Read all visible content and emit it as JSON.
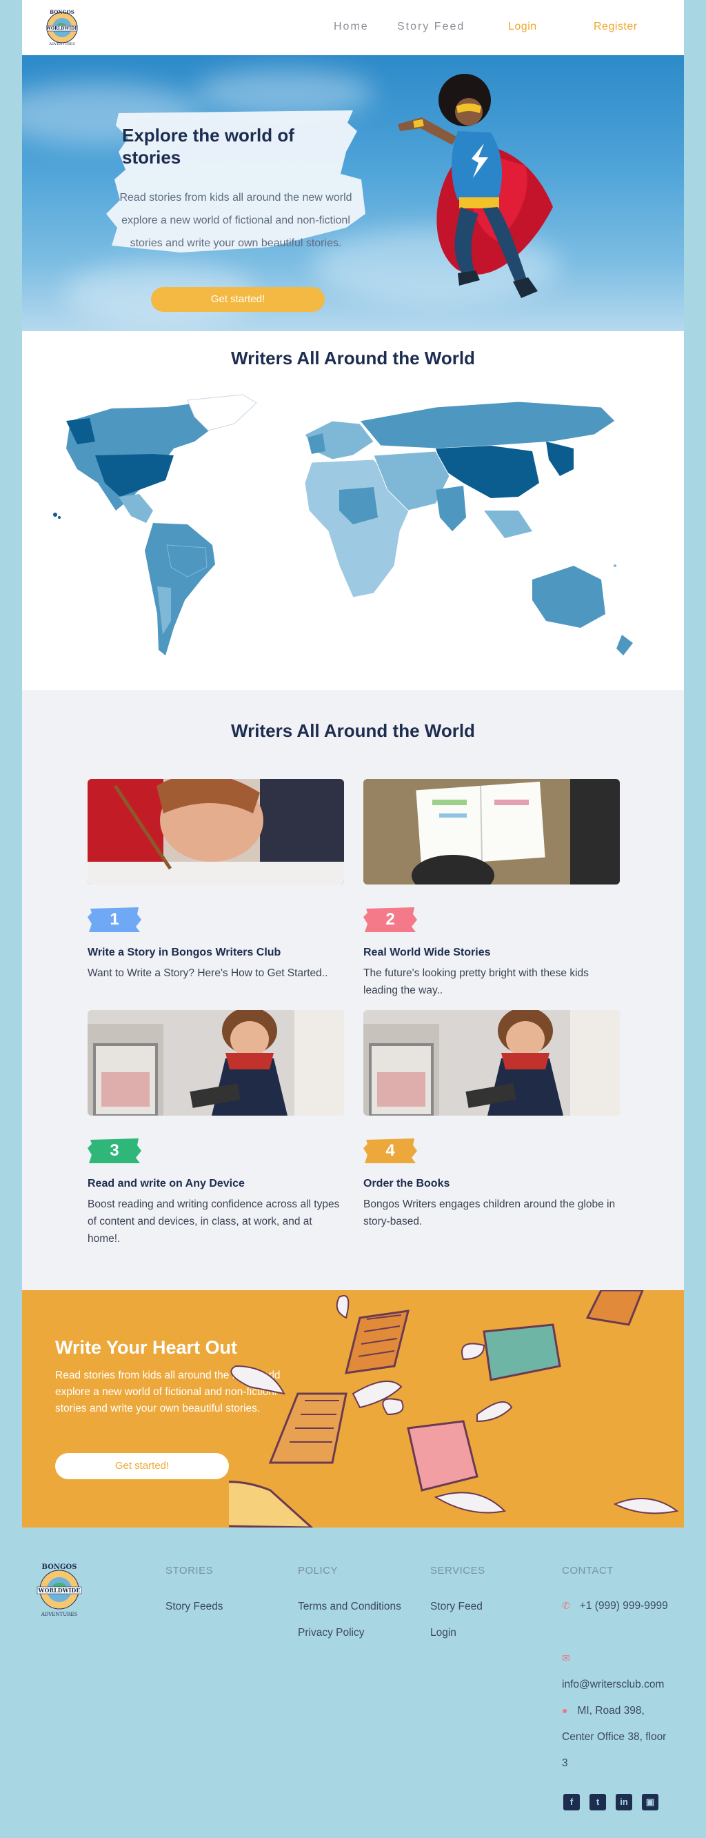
{
  "brand": {
    "logo_top": "BONGOS",
    "logo_band": "WORLDWIDE",
    "logo_bottom": "ADVENTURES"
  },
  "nav": {
    "home": "Home",
    "story_feed": "Story Feed",
    "login": "Login",
    "register": "Register"
  },
  "hero": {
    "title": "Explore the world of stories",
    "text": "Read stories from kids all around the new world explore a new world of fictional and non-fictionl stories and write your own beautiful stories.",
    "cta": "Get started!"
  },
  "map_section": {
    "title": "Writers All Around the World"
  },
  "steps_section": {
    "title": "Writers All Around the World",
    "cards": [
      {
        "number": "1",
        "color": "#6fa8f5",
        "title": "Write a Story in Bongos Writers Club",
        "text": "Want to Write a Story? Here's How to Get Started.."
      },
      {
        "number": "2",
        "color": "#f47a8a",
        "title": "Real World Wide Stories",
        "text": "The future's looking pretty bright with these kids leading the way.."
      },
      {
        "number": "3",
        "color": "#2fb77a",
        "title": "Read and write on Any Device",
        "text": "Boost reading and writing confidence across all types of content and devices, in class, at work, and at home!."
      },
      {
        "number": "4",
        "color": "#eca83a",
        "title": "Order the Books",
        "text": "Bongos Writers engages children around the globe in story-based."
      }
    ]
  },
  "cta": {
    "title": "Write Your Heart Out",
    "text": "Read stories from kids all around the new world explore a new world of fictional and non-fictionl stories and write your own beautiful stories.",
    "button": "Get started!"
  },
  "footer": {
    "stories": {
      "heading": "STORIES",
      "links": [
        "Story Feeds"
      ]
    },
    "policy": {
      "heading": "POLICY",
      "links": [
        "Terms and Conditions",
        "Privacy Policy"
      ]
    },
    "services": {
      "heading": "SERVICES",
      "links": [
        "Story Feed",
        "Login"
      ]
    },
    "contact": {
      "heading": "CONTACT",
      "phone": "+1 (999) 999-9999",
      "email": "info@writersclub.com",
      "address": "MI, Road 398, Center Office 38, floor 3"
    },
    "social": [
      "facebook-icon",
      "twitter-icon",
      "linkedin-icon",
      "instagram-icon"
    ]
  }
}
